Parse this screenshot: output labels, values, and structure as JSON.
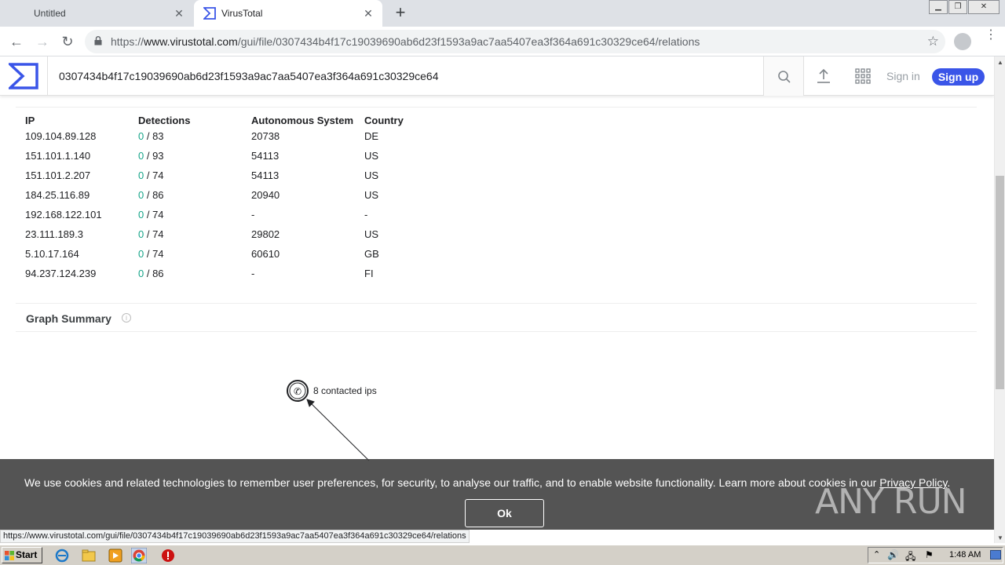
{
  "browser": {
    "tabs": [
      {
        "title": "Untitled",
        "active": false
      },
      {
        "title": "VirusTotal",
        "active": true
      }
    ],
    "new_tab": "+",
    "window_controls": [
      "minimize",
      "restore",
      "close"
    ],
    "url_prefix": "https://",
    "url_host": "www.virustotal.com",
    "url_path": "/gui/file/0307434b4f17c19039690ab6d23f1593a9ac7aa5407ea3f364a691c30329ce64/relations",
    "status_url": "https://www.virustotal.com/gui/file/0307434b4f17c19039690ab6d23f1593a9ac7aa5407ea3f364a691c30329ce64/relations"
  },
  "vt_header": {
    "search_value": "0307434b4f17c19039690ab6d23f1593a9ac7aa5407ea3f364a691c30329ce64",
    "sign_in": "Sign in",
    "sign_up": "Sign up",
    "accent_color": "#3a55e8"
  },
  "ip_table": {
    "headers": [
      "IP",
      "Detections",
      "Autonomous System",
      "Country"
    ],
    "rows": [
      {
        "ip": "109.104.89.128",
        "det": "0",
        "total": " / 83",
        "as": "20738",
        "country": "DE"
      },
      {
        "ip": "151.101.1.140",
        "det": "0",
        "total": " / 93",
        "as": "54113",
        "country": "US"
      },
      {
        "ip": "151.101.2.207",
        "det": "0",
        "total": " / 74",
        "as": "54113",
        "country": "US"
      },
      {
        "ip": "184.25.116.89",
        "det": "0",
        "total": " / 86",
        "as": "20940",
        "country": "US"
      },
      {
        "ip": "192.168.122.101",
        "det": "0",
        "total": " / 74",
        "as": "-",
        "country": "-"
      },
      {
        "ip": "23.111.189.3",
        "det": "0",
        "total": " / 74",
        "as": "29802",
        "country": "US"
      },
      {
        "ip": "5.10.17.164",
        "det": "0",
        "total": " / 74",
        "as": "60610",
        "country": "GB"
      },
      {
        "ip": "94.237.124.239",
        "det": "0",
        "total": " / 86",
        "as": "-",
        "country": "FI"
      }
    ],
    "zero_color": "#17a589"
  },
  "graph_summary": {
    "title": "Graph Summary",
    "node_label": "8 contacted ips"
  },
  "cookie_banner": {
    "message": "We use cookies and related technologies to remember user preferences, for security, to analyse our traffic, and to enable website functionality. Learn more about cookies in our ",
    "link": "Privacy Policy",
    "suffix": ".",
    "ok": "Ok"
  },
  "watermark": "ANY RUN",
  "taskbar": {
    "start": "Start",
    "clock": "1:48 AM"
  }
}
